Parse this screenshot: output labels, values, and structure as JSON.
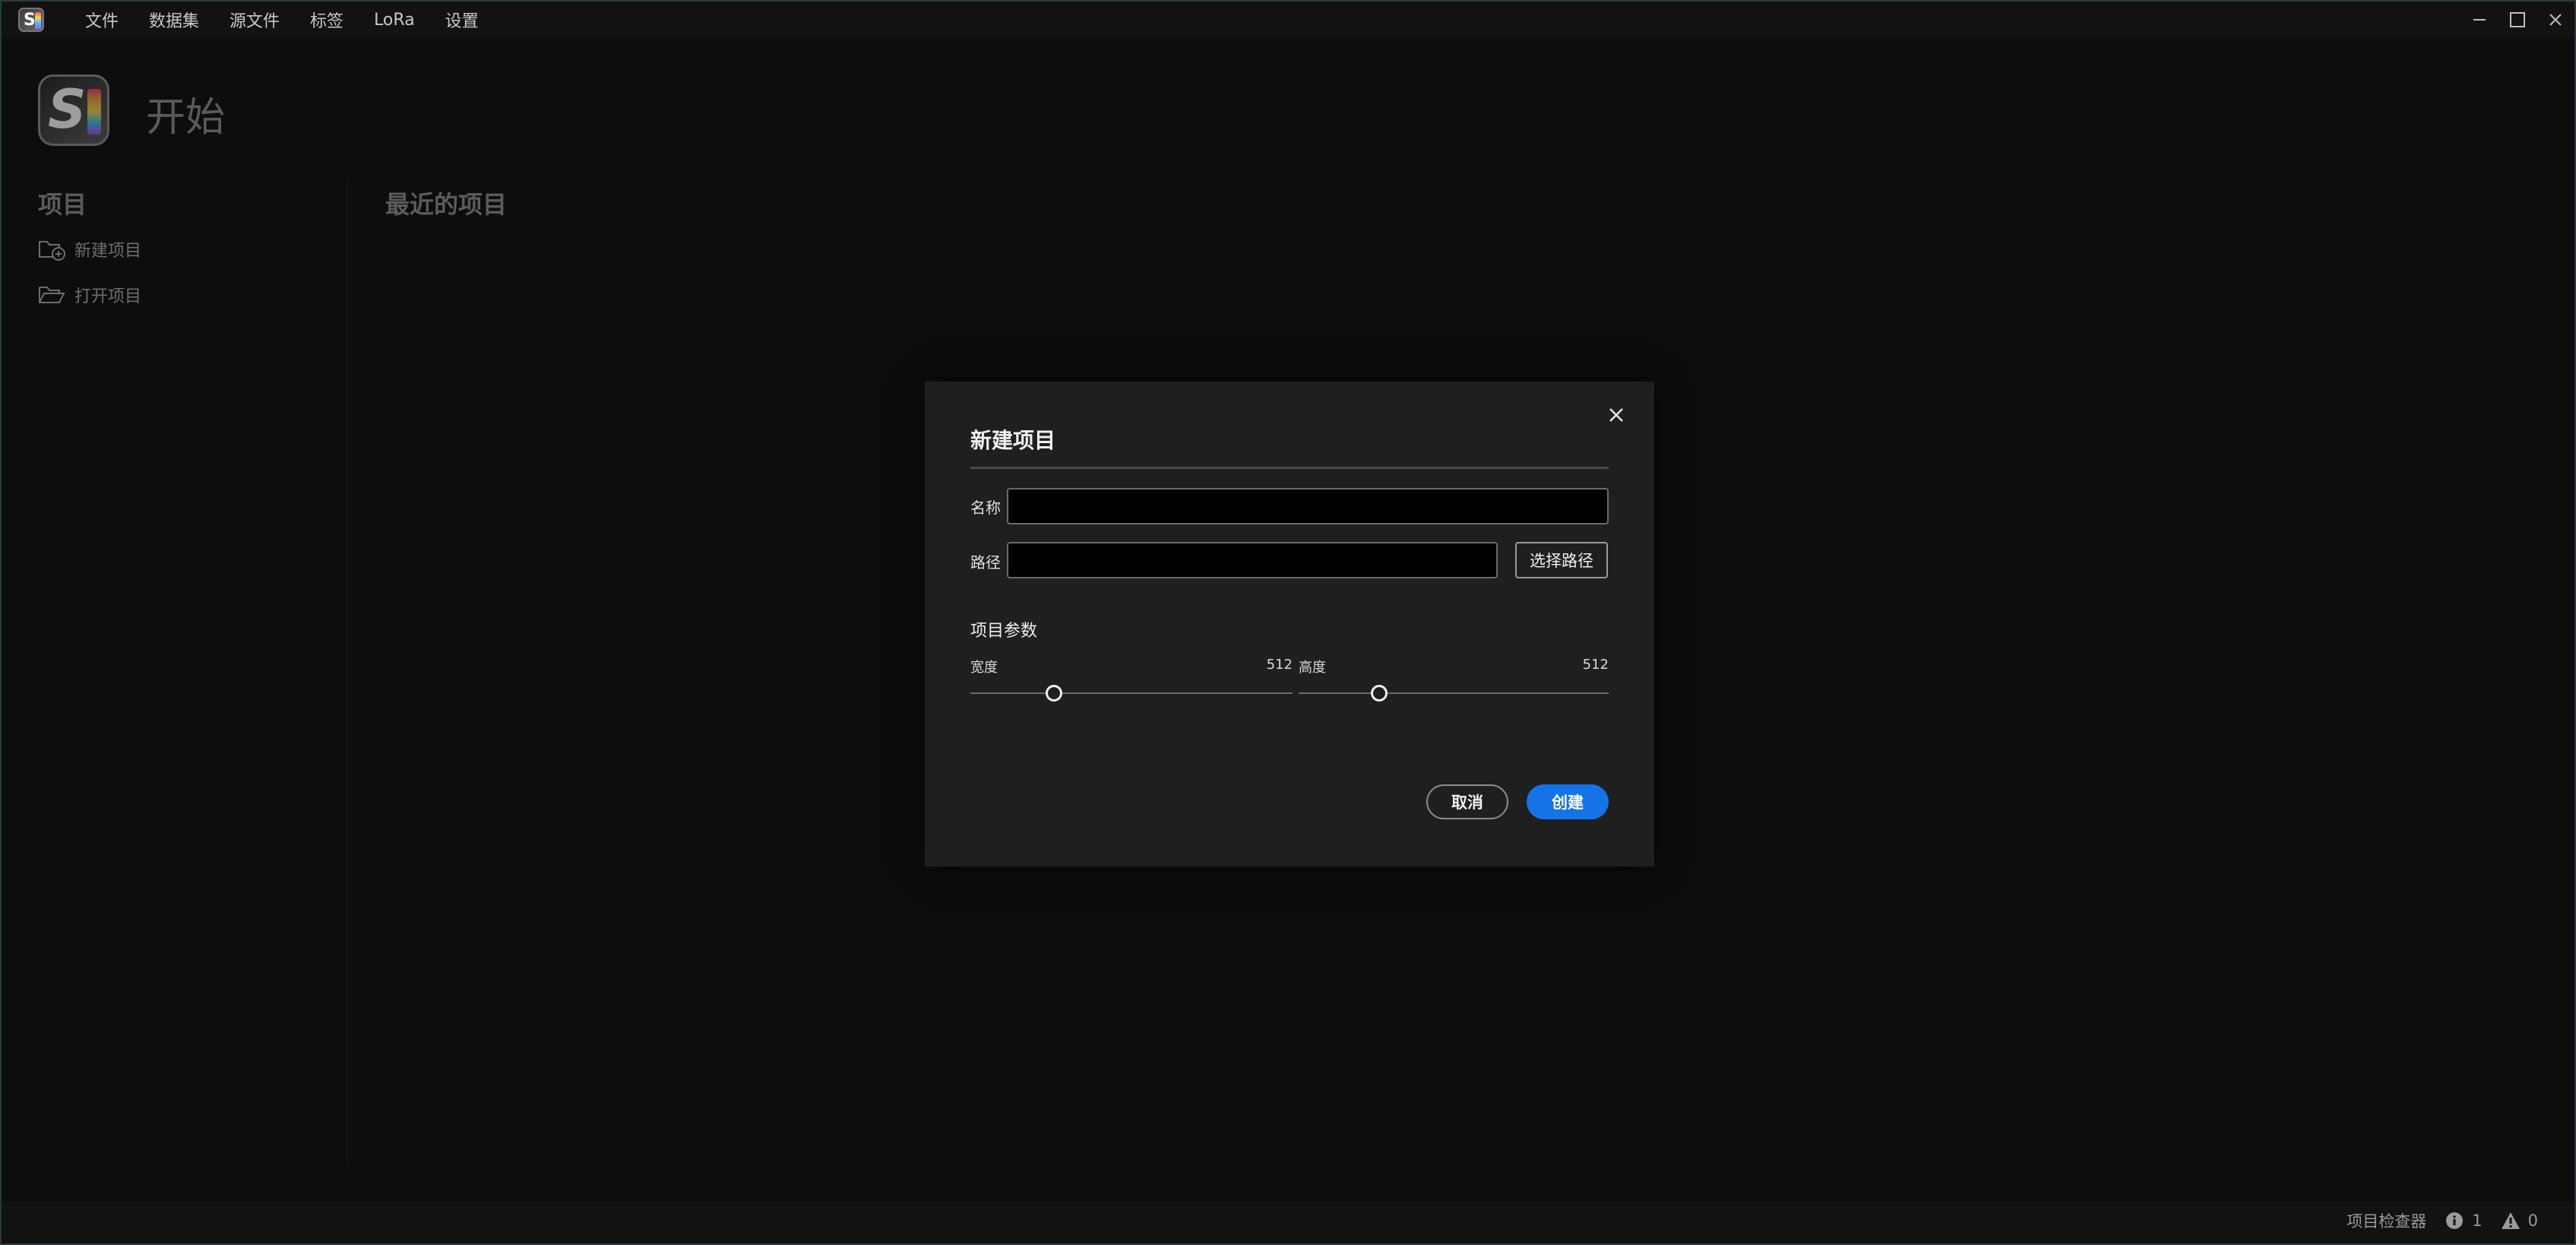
{
  "app": {
    "menu": [
      "文件",
      "数据集",
      "源文件",
      "标签",
      "LoRa",
      "设置"
    ],
    "page_title": "开始"
  },
  "sidebar": {
    "section_title": "项目",
    "items": [
      {
        "label": "新建项目",
        "icon": "new-folder-icon"
      },
      {
        "label": "打开项目",
        "icon": "open-folder-icon"
      }
    ]
  },
  "main": {
    "recent_title": "最近的项目"
  },
  "dialog": {
    "title": "新建项目",
    "name_label": "名称",
    "name_value": "",
    "path_label": "路径",
    "path_value": "",
    "choose_path_label": "选择路径",
    "params_title": "项目参数",
    "width_label": "宽度",
    "width_value": "512",
    "height_label": "高度",
    "height_value": "512",
    "slider_fraction": 0.26,
    "cancel_label": "取消",
    "create_label": "创建"
  },
  "statusbar": {
    "inspector_label": "项目检查器",
    "info_count": "1",
    "warning_count": "0"
  },
  "colors": {
    "accent": "#1473e6",
    "background": "#151515",
    "dialog": "#1f1f1f"
  }
}
